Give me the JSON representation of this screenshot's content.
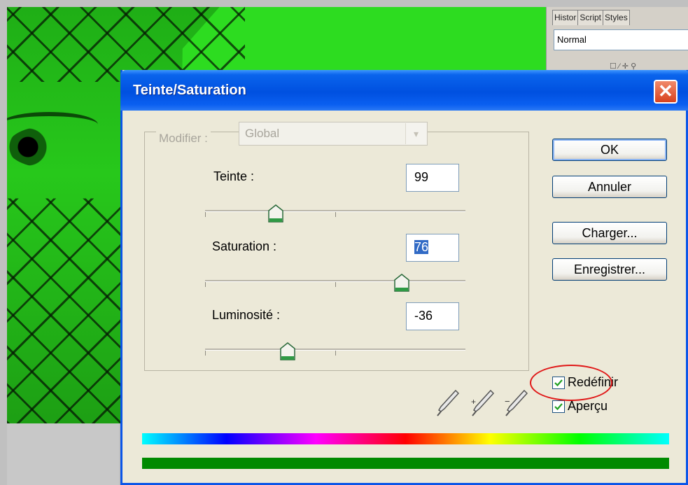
{
  "side_panel": {
    "tabs": [
      "Histor",
      "Script",
      "Styles"
    ],
    "blend_mode": "Normal"
  },
  "dialog": {
    "title": "Teinte/Saturation",
    "close_glyph": "✕",
    "modifier": {
      "label": "Modifier :",
      "value": "Global"
    },
    "sliders": [
      {
        "label": "Teinte :",
        "value": "99",
        "level": 0.27
      },
      {
        "label": "Saturation :",
        "value": "76",
        "level": 0.76
      },
      {
        "label": "Luminosité :",
        "value": "-36",
        "level": 0.32
      }
    ],
    "buttons": {
      "ok": "OK",
      "cancel": "Annuler",
      "load": "Charger...",
      "save": "Enregistrer..."
    },
    "checkboxes": {
      "colorize": {
        "label": "Redéfinir",
        "checked": true
      },
      "preview": {
        "label": "Aperçu",
        "checked": true
      }
    },
    "colors": {
      "title_bar": "#0050e0",
      "annotation": "#e01818",
      "result_bar": "#008a00"
    }
  }
}
